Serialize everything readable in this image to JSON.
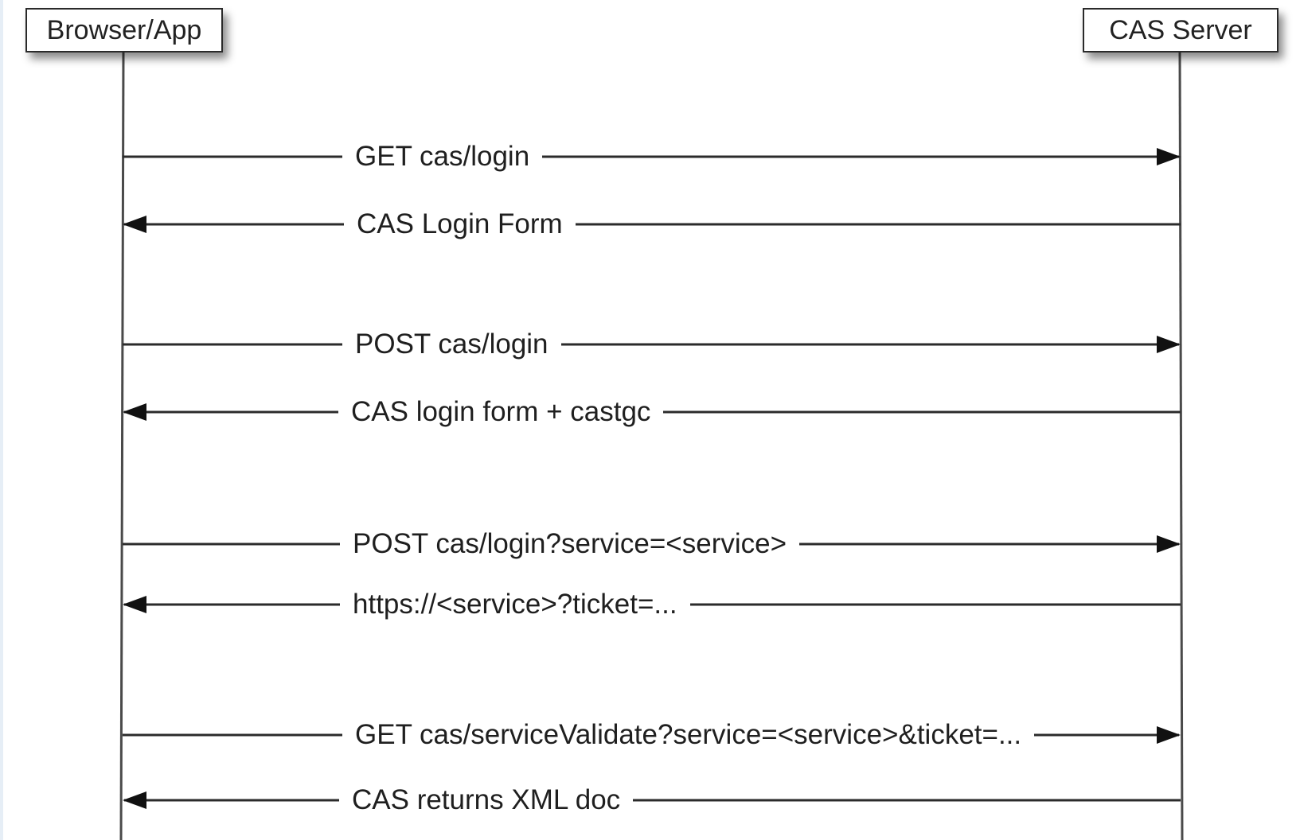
{
  "actors": {
    "left": "Browser/App",
    "right": "CAS Server"
  },
  "messages": [
    {
      "label": "GET cas/login",
      "direction": "to-server"
    },
    {
      "label": "CAS Login Form",
      "direction": "to-client"
    },
    {
      "label": "POST cas/login",
      "direction": "to-server"
    },
    {
      "label": "CAS login form + castgc",
      "direction": "to-client"
    },
    {
      "label": "POST cas/login?service=<service>",
      "direction": "to-server"
    },
    {
      "label": "https://<service>?ticket=...",
      "direction": "to-client"
    },
    {
      "label": "GET cas/serviceValidate?service=<service>&ticket=...",
      "direction": "to-server"
    },
    {
      "label": "CAS returns XML doc",
      "direction": "to-client"
    }
  ],
  "colors": {
    "line": "#2b2b2b",
    "text": "#1f1f1f"
  }
}
